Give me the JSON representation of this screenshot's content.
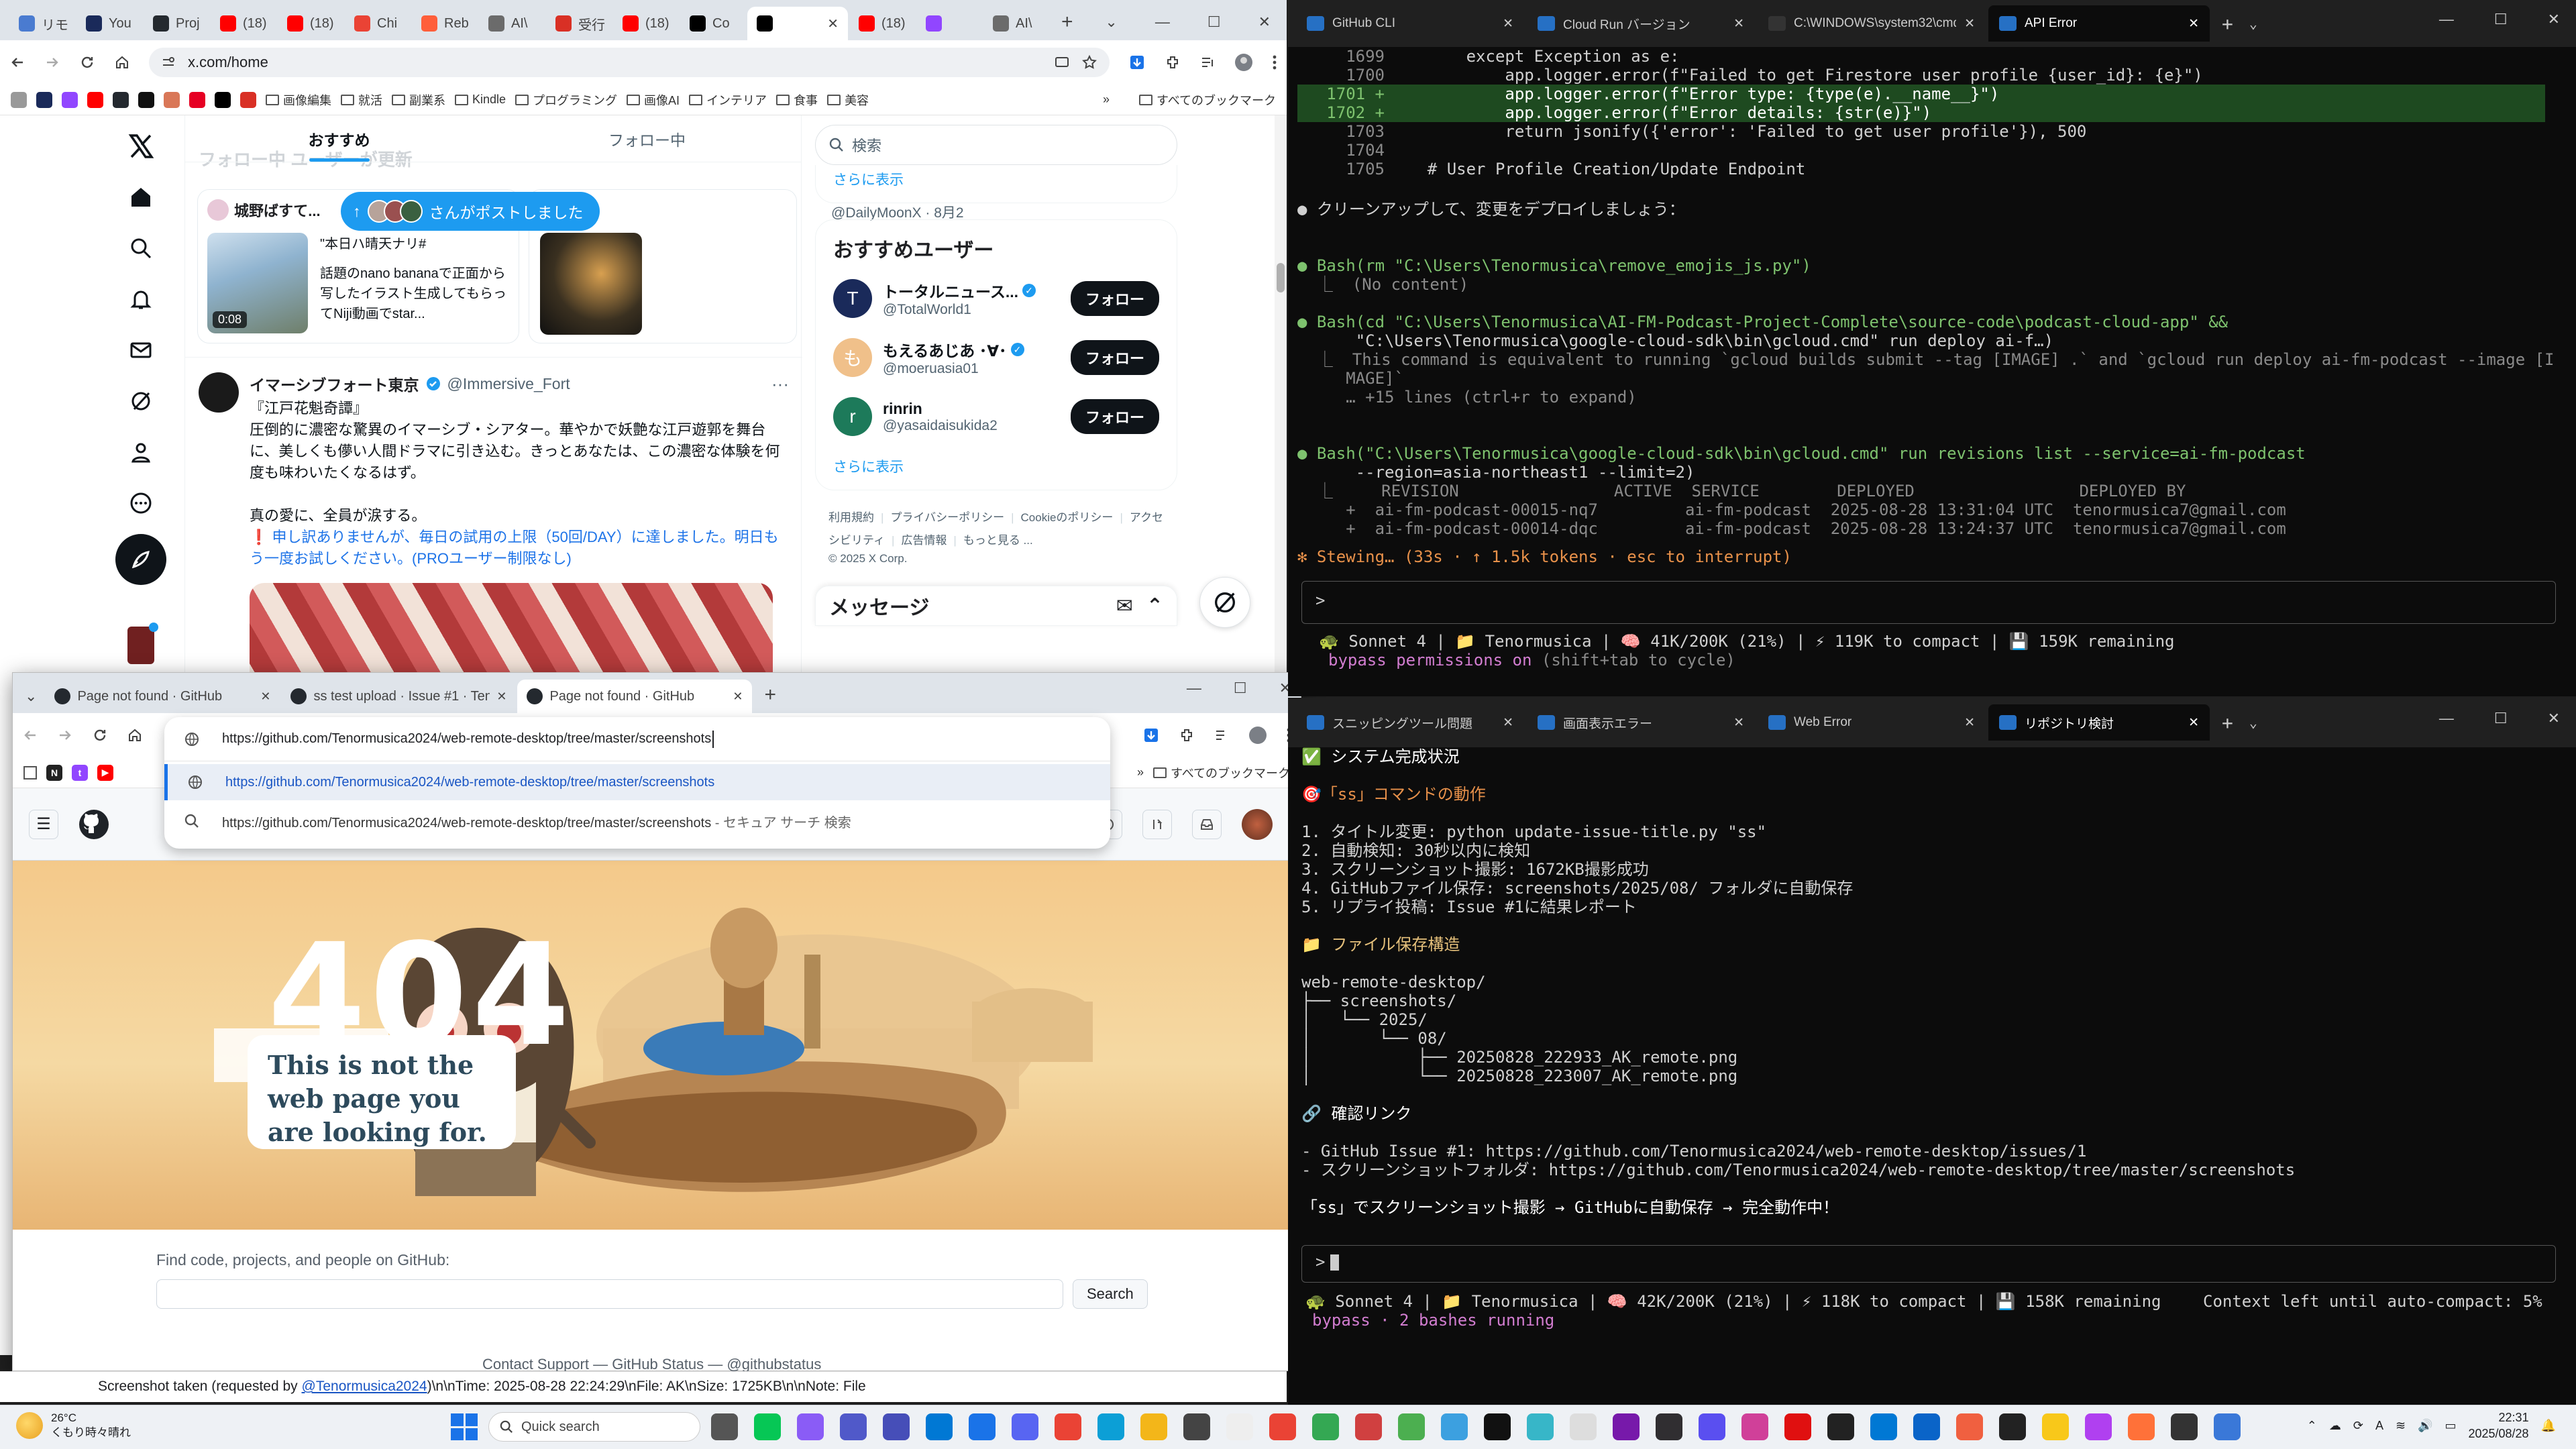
{
  "chromeA": {
    "tabs": [
      {
        "label": "リモ",
        "icon": "doc-icon"
      },
      {
        "label": "You",
        "icon": "n-icon"
      },
      {
        "label": "Proj",
        "icon": "github-icon"
      },
      {
        "label": "(18)",
        "icon": "youtube-icon"
      },
      {
        "label": "(18)",
        "icon": "youtube-icon"
      },
      {
        "label": "Chi",
        "icon": "chrome-icon"
      },
      {
        "label": "Reb",
        "icon": "r-icon"
      },
      {
        "label": "AI\\",
        "icon": "ai-icon"
      },
      {
        "label": "受行",
        "icon": "gmail-icon"
      },
      {
        "label": "(18)",
        "icon": "youtube-icon"
      },
      {
        "label": "Co",
        "icon": "x-icon"
      },
      {
        "label": "",
        "icon": "x-icon"
      },
      {
        "label": "(18)",
        "icon": "youtube-icon"
      },
      {
        "label": "",
        "icon": "twitch-icon"
      },
      {
        "label": "AI\\",
        "icon": "ai-icon"
      }
    ],
    "url": "x.com/home",
    "bookmarks": [
      "画像編集",
      "就活",
      "副業系",
      "Kindle",
      "プログラミング",
      "画像AI",
      "インテリア",
      "食事",
      "美容"
    ],
    "all_bookmarks": "すべてのブックマーク"
  },
  "x": {
    "tabs": [
      "おすすめ",
      "フォロー中"
    ],
    "header_faded": "フォロー中 ユーザーが更新",
    "toast": "さんがポストしました",
    "card1": {
      "user": "城野ばすて...",
      "handle": "@DailyMoonX · 8月2",
      "title": "\"本日ハ晴天ナリ#",
      "body": "話題のnano bananaで正面から写したイラスト生成してもらってNiji動画でstar...",
      "duration": "0:08"
    },
    "post": {
      "name": "イマーシブフォート東京",
      "handle": "@Immersive_Fort",
      "quote": "『江戸花魁奇譚』",
      "body": "圧倒的に濃密な驚異のイマーシブ・シアター。華やかで妖艶な江戸遊郭を舞台に、美しくも儚い人間ドラマに引き込む。きっとあなたは、この濃密な体験を何度も味わいたくなるはず。",
      "body2": "真の愛に、全員が涙する。",
      "notice": "❗ 申し訳ありませんが、毎日の試用の上限（50回/DAY）に達しました。明日もう一度お試しください。(PROユーザー制限なし)"
    },
    "search_placeholder": "検索",
    "show_more": "さらに表示",
    "recommend_title": "おすすめユーザー",
    "users": [
      {
        "name": "トータルニュース...",
        "handle": "@TotalWorld1",
        "button": "フォロー",
        "avatar": "T",
        "color": "#1a2a5a"
      },
      {
        "name": "もえるあじあ ･∀･",
        "handle": "@moeruasia01",
        "button": "フォロー",
        "avatar": "も",
        "color": "#f0c08a"
      },
      {
        "name": "rinrin",
        "handle": "@yasaidaisukida2",
        "button": "フォロー",
        "avatar": "r",
        "color": "#1d7a5a"
      }
    ],
    "show_more2": "さらに表示",
    "footer_links": [
      "利用規約",
      "プライバシーポリシー",
      "Cookieのポリシー",
      "アクセシビリティ",
      "広告情報",
      "もっと見る ..."
    ],
    "copyright": "© 2025 X Corp.",
    "messages": "メッセージ"
  },
  "chromeB": {
    "tabs": [
      {
        "label": "Page not found · GitHub"
      },
      {
        "label": "ss test upload · Issue #1 · Tenor"
      },
      {
        "label": "Page not found · GitHub"
      }
    ],
    "url": "https://github.com/Tenormusica2024/web-remote-desktop/tree/master/screenshots",
    "suggestions": [
      {
        "text": "https://github.com/Tenormusica2024/web-remote-desktop/tree/master/screenshots",
        "suffix": ""
      },
      {
        "text": "https://github.com/Tenormusica2024/web-remote-desktop/tree/master/screenshots",
        "suffix": " - セキュア サーチ 検索"
      }
    ],
    "all_bookmarks": "すべてのブックマーク",
    "big404": "404",
    "msg_lines": [
      "This is not the",
      "web page you",
      "are looking for."
    ],
    "find_label": "Find code, projects, and people on GitHub:",
    "search_button": "Search",
    "footer": "Contact Support — GitHub Status — @githubstatus"
  },
  "statusbar": {
    "prefix": "Screenshot taken (requested by ",
    "user": "@Tenormusica2024",
    "suffix": ")\\n\\nTime: 2025-08-28 22:24:29\\nFile: AK\\nSize: 1725KB\\n\\nNote: File"
  },
  "term1": {
    "tabs": [
      "GitHub CLI",
      "Cloud Run バージョン",
      "C:\\WINDOWS\\system32\\cmd.",
      "API Error"
    ],
    "diff": [
      {
        "n": "1699",
        "t": "        except Exception as e:",
        "hl": false
      },
      {
        "n": "1700",
        "t": "            app.logger.error(f\"Failed to get Firestore user profile {user_id}: {e}\")",
        "hl": false
      },
      {
        "n": "1701 +",
        "t": "            app.logger.error(f\"Error type: {type(e).__name__}\")",
        "hl": true
      },
      {
        "n": "1702 +",
        "t": "            app.logger.error(f\"Error details: {str(e)}\")",
        "hl": true
      },
      {
        "n": "1703",
        "t": "            return jsonify({'error': 'Failed to get user profile'}), 500",
        "hl": false
      },
      {
        "n": "1704",
        "t": "",
        "hl": false
      },
      {
        "n": "1705",
        "t": "    # User Profile Creation/Update Endpoint",
        "hl": false
      }
    ],
    "lines": [
      "● クリーンアップして、変更をデプロイしましょう：",
      "● Bash(rm \"C:\\Users\\Tenormusica\\remove_emojis_js.py\")",
      "  ⎿  (No content)",
      "● Bash(cd \"C:\\Users\\Tenormusica\\AI-FM-Podcast-Project-Complete\\source-code\\podcast-cloud-app\" &&",
      "      \"C:\\Users\\Tenormusica\\google-cloud-sdk\\bin\\gcloud.cmd\" run deploy ai-f…)",
      "  ⎿  This command is equivalent to running `gcloud builds submit --tag [IMAGE] .` and `gcloud run deploy ai-fm-podcast --image [I",
      "     MAGE]`",
      "     … +15 lines (ctrl+r to expand)",
      "● Bash(\"C:\\Users\\Tenormusica\\google-cloud-sdk\\bin\\gcloud.cmd\" run revisions list --service=ai-fm-podcast",
      "      --region=asia-northeast1 --limit=2)",
      "  ⎿     REVISION                ACTIVE  SERVICE        DEPLOYED                 DEPLOYED BY",
      "     +  ai-fm-podcast-00015-nq7         ai-fm-podcast  2025-08-28 13:31:04 UTC  tenormusica7@gmail.com",
      "     +  ai-fm-podcast-00014-dqc         ai-fm-podcast  2025-08-28 13:24:37 UTC  tenormusica7@gmail.com"
    ],
    "stewing": "✻ Stewing… (33s · ↑ 1.5k tokens · esc to interrupt)",
    "prompt": ">",
    "status": "🐢 Sonnet 4 | 📁 Tenormusica | 🧠 41K/200K (21%) | ⚡ 119K to compact | 💾 159K remaining",
    "bypass": "bypass permissions on",
    "bypass_hint": " (shift+tab to cycle)"
  },
  "term2": {
    "tabs": [
      "スニッピングツール問題",
      "画面表示エラー",
      "Web Error",
      "リポジトリ検討"
    ],
    "lines": [
      "✅ システム完成状況",
      "",
      "🎯「ss」コマンドの動作",
      "",
      "1. タイトル変更: python update-issue-title.py \"ss\"",
      "2. 自動検知: 30秒以内に検知",
      "3. スクリーンショット撮影: 1672KB撮影成功",
      "4. GitHubファイル保存: screenshots/2025/08/ フォルダに自動保存",
      "5. リプライ投稿: Issue #1に結果レポート",
      "",
      "📁 ファイル保存構造",
      "",
      "web-remote-desktop/",
      "├── screenshots/",
      "│   └── 2025/",
      "│       └── 08/",
      "│           ├── 20250828_222933_AK_remote.png",
      "│           └── 20250828_223007_AK_remote.png",
      "",
      "🔗 確認リンク",
      "",
      "- GitHub Issue #1: https://github.com/Tenormusica2024/web-remote-desktop/issues/1",
      "- スクリーンショットフォルダ: https://github.com/Tenormusica2024/web-remote-desktop/tree/master/screenshots",
      "",
      "「ss」でスクリーンショット撮影 → GitHubに自動保存 → 完全動作中！"
    ],
    "prompt": ">",
    "status": "🐢 Sonnet 4 | 📁 Tenormusica | 🧠 42K/200K (21%) | ⚡ 118K to compact | 💾 158K remaining",
    "context": "Context left until auto-compact: 5%",
    "bypass": "bypass",
    "bashes": " · 2 bashes running"
  },
  "taskbar": {
    "weather_temp": "26°C",
    "weather_desc": "くもり時々晴れ",
    "search": "Quick search",
    "time": "22:31",
    "date": "2025/08/28",
    "ime": "A"
  }
}
